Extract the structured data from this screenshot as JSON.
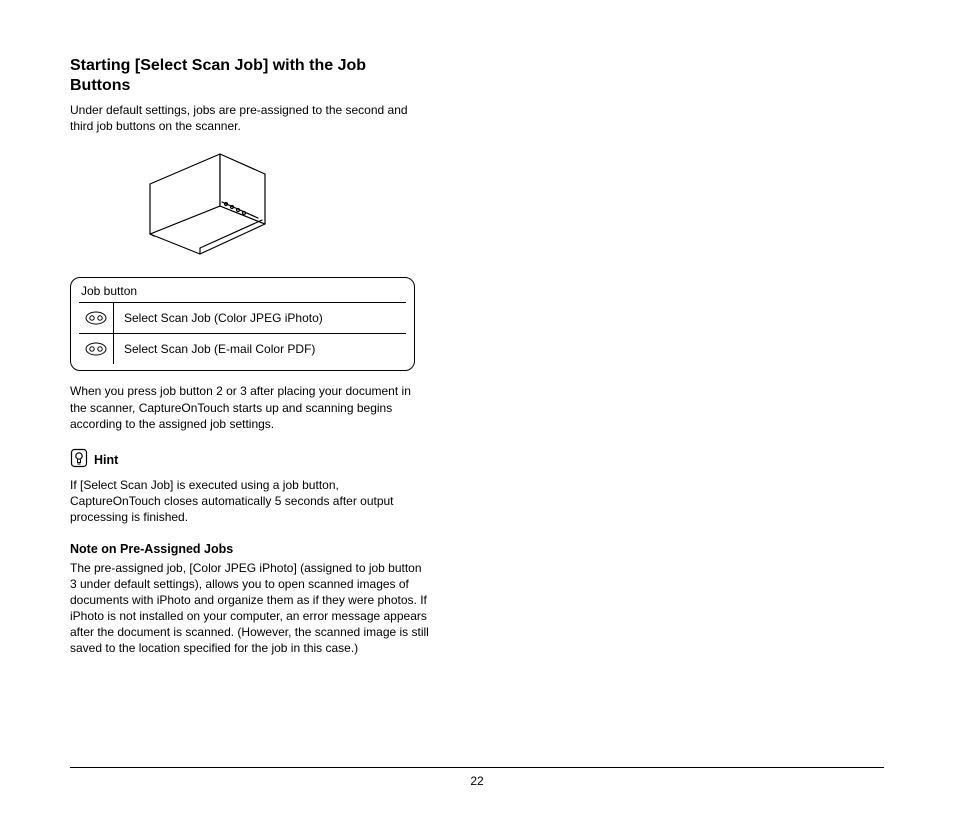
{
  "title": "Starting [Select Scan Job] with the Job Buttons",
  "intro": "Under default settings, jobs are pre-assigned to the second and third job buttons on the scanner.",
  "table": {
    "header": "Job button",
    "rows": [
      {
        "label": "Select Scan Job (Color JPEG iPhoto)"
      },
      {
        "label": "Select Scan Job (E-mail Color PDF)"
      }
    ]
  },
  "after_table": "When you press job button 2 or 3 after placing your document in the scanner, CaptureOnTouch starts up and scanning begins according to the assigned job settings.",
  "hint": {
    "label": "Hint",
    "text": "If [Select Scan Job] is executed using a job button, CaptureOnTouch closes automatically 5 seconds after output processing is finished."
  },
  "note": {
    "heading": "Note on Pre-Assigned Jobs",
    "text": "The pre-assigned job, [Color JPEG iPhoto] (assigned to job button 3 under default settings), allows you to open scanned images of documents with iPhoto and organize them as if they were photos. If iPhoto is not installed on your computer, an error message appears after the document is scanned. (However, the scanned image is still saved to the location specified for the job in this case.)"
  },
  "page_number": "22"
}
